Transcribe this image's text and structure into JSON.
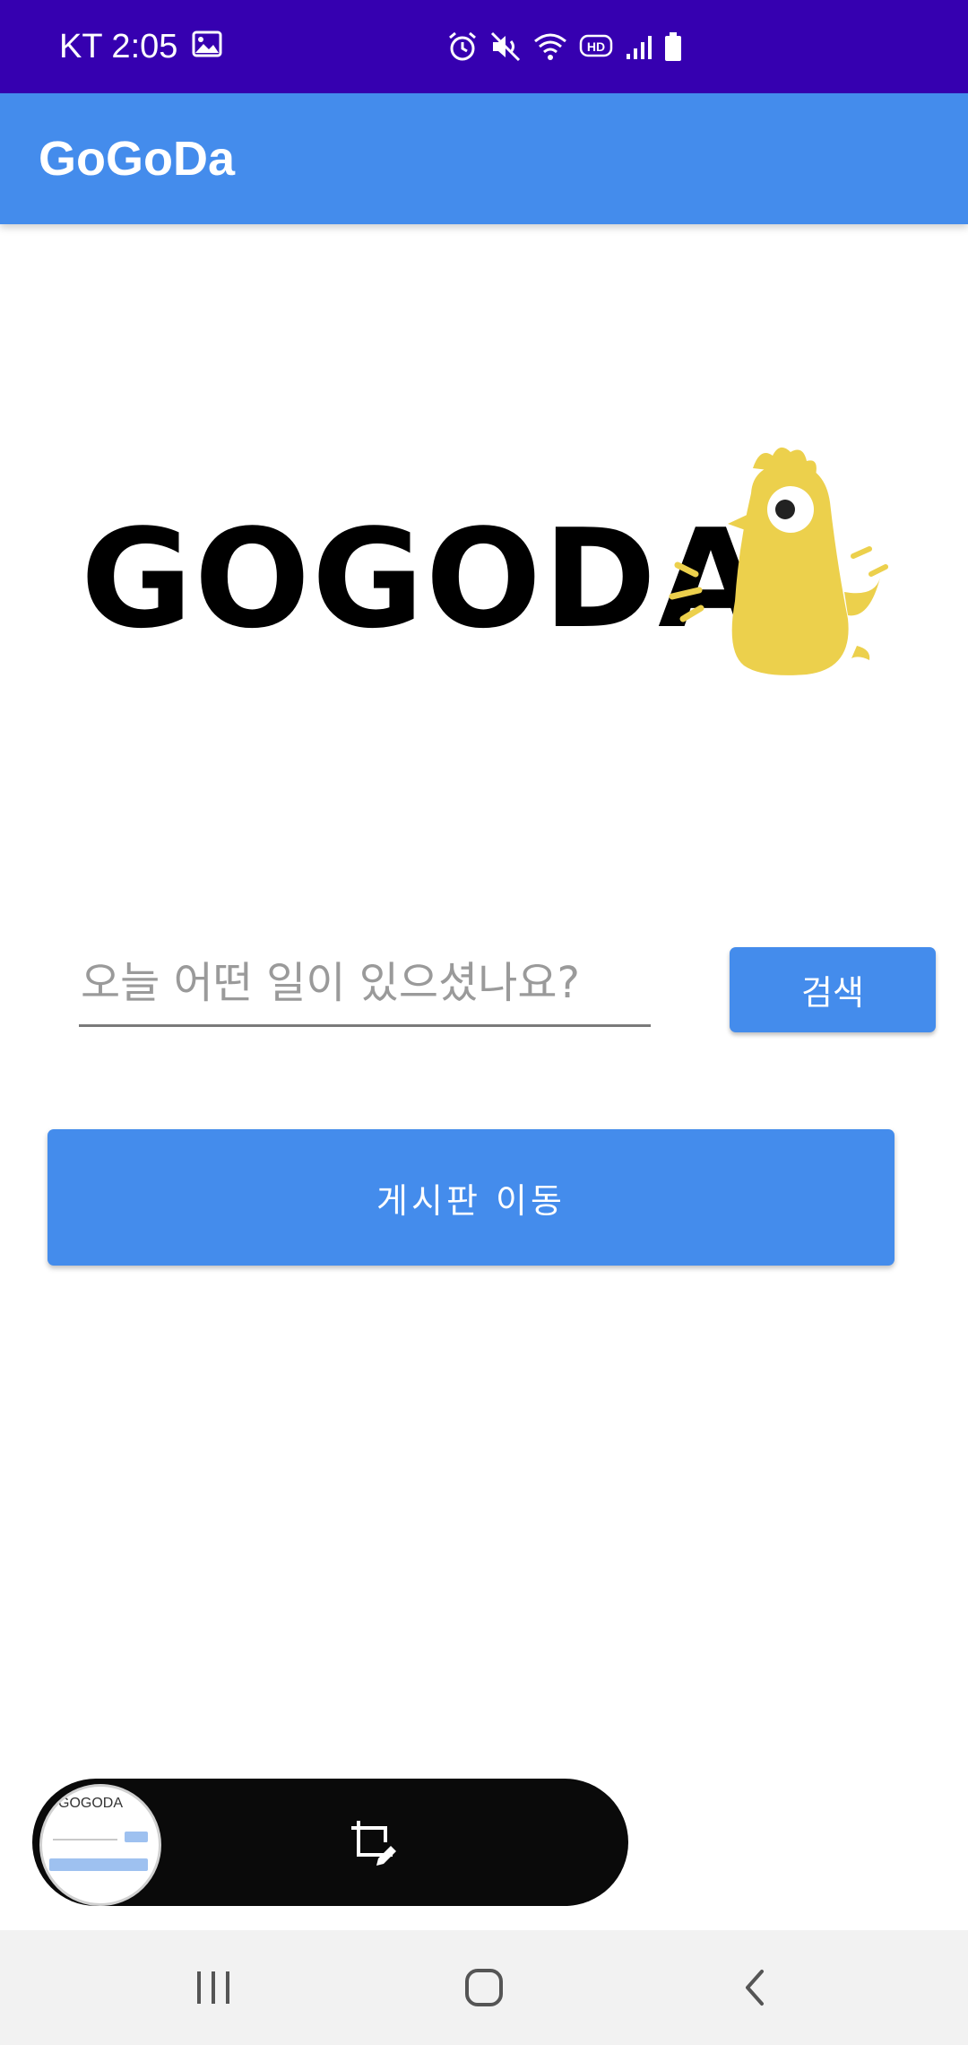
{
  "status_bar": {
    "carrier_time": "KT 2:05",
    "icons": [
      "image-icon",
      "alarm-icon",
      "mute-icon",
      "wifi-icon",
      "hd-icon",
      "signal-icon",
      "battery-icon"
    ],
    "hd_label": "HD",
    "background_color": "#3600b0"
  },
  "app_bar": {
    "title": "GoGoDa",
    "color": "#448cec"
  },
  "logo": {
    "wordmark": "GOGODA",
    "mascot_color": "#ecd04c"
  },
  "search": {
    "placeholder": "오늘 어떤 일이 있으셨나요?",
    "value": "",
    "button_label": "검색"
  },
  "board_button": {
    "label": "게시판 이동"
  },
  "capture_toolbar": {
    "thumbnail_text": "GOGODA",
    "icon": "crop-edit-icon"
  },
  "nav_bar": {
    "items": [
      "recent-apps-icon",
      "home-icon",
      "back-icon"
    ]
  }
}
